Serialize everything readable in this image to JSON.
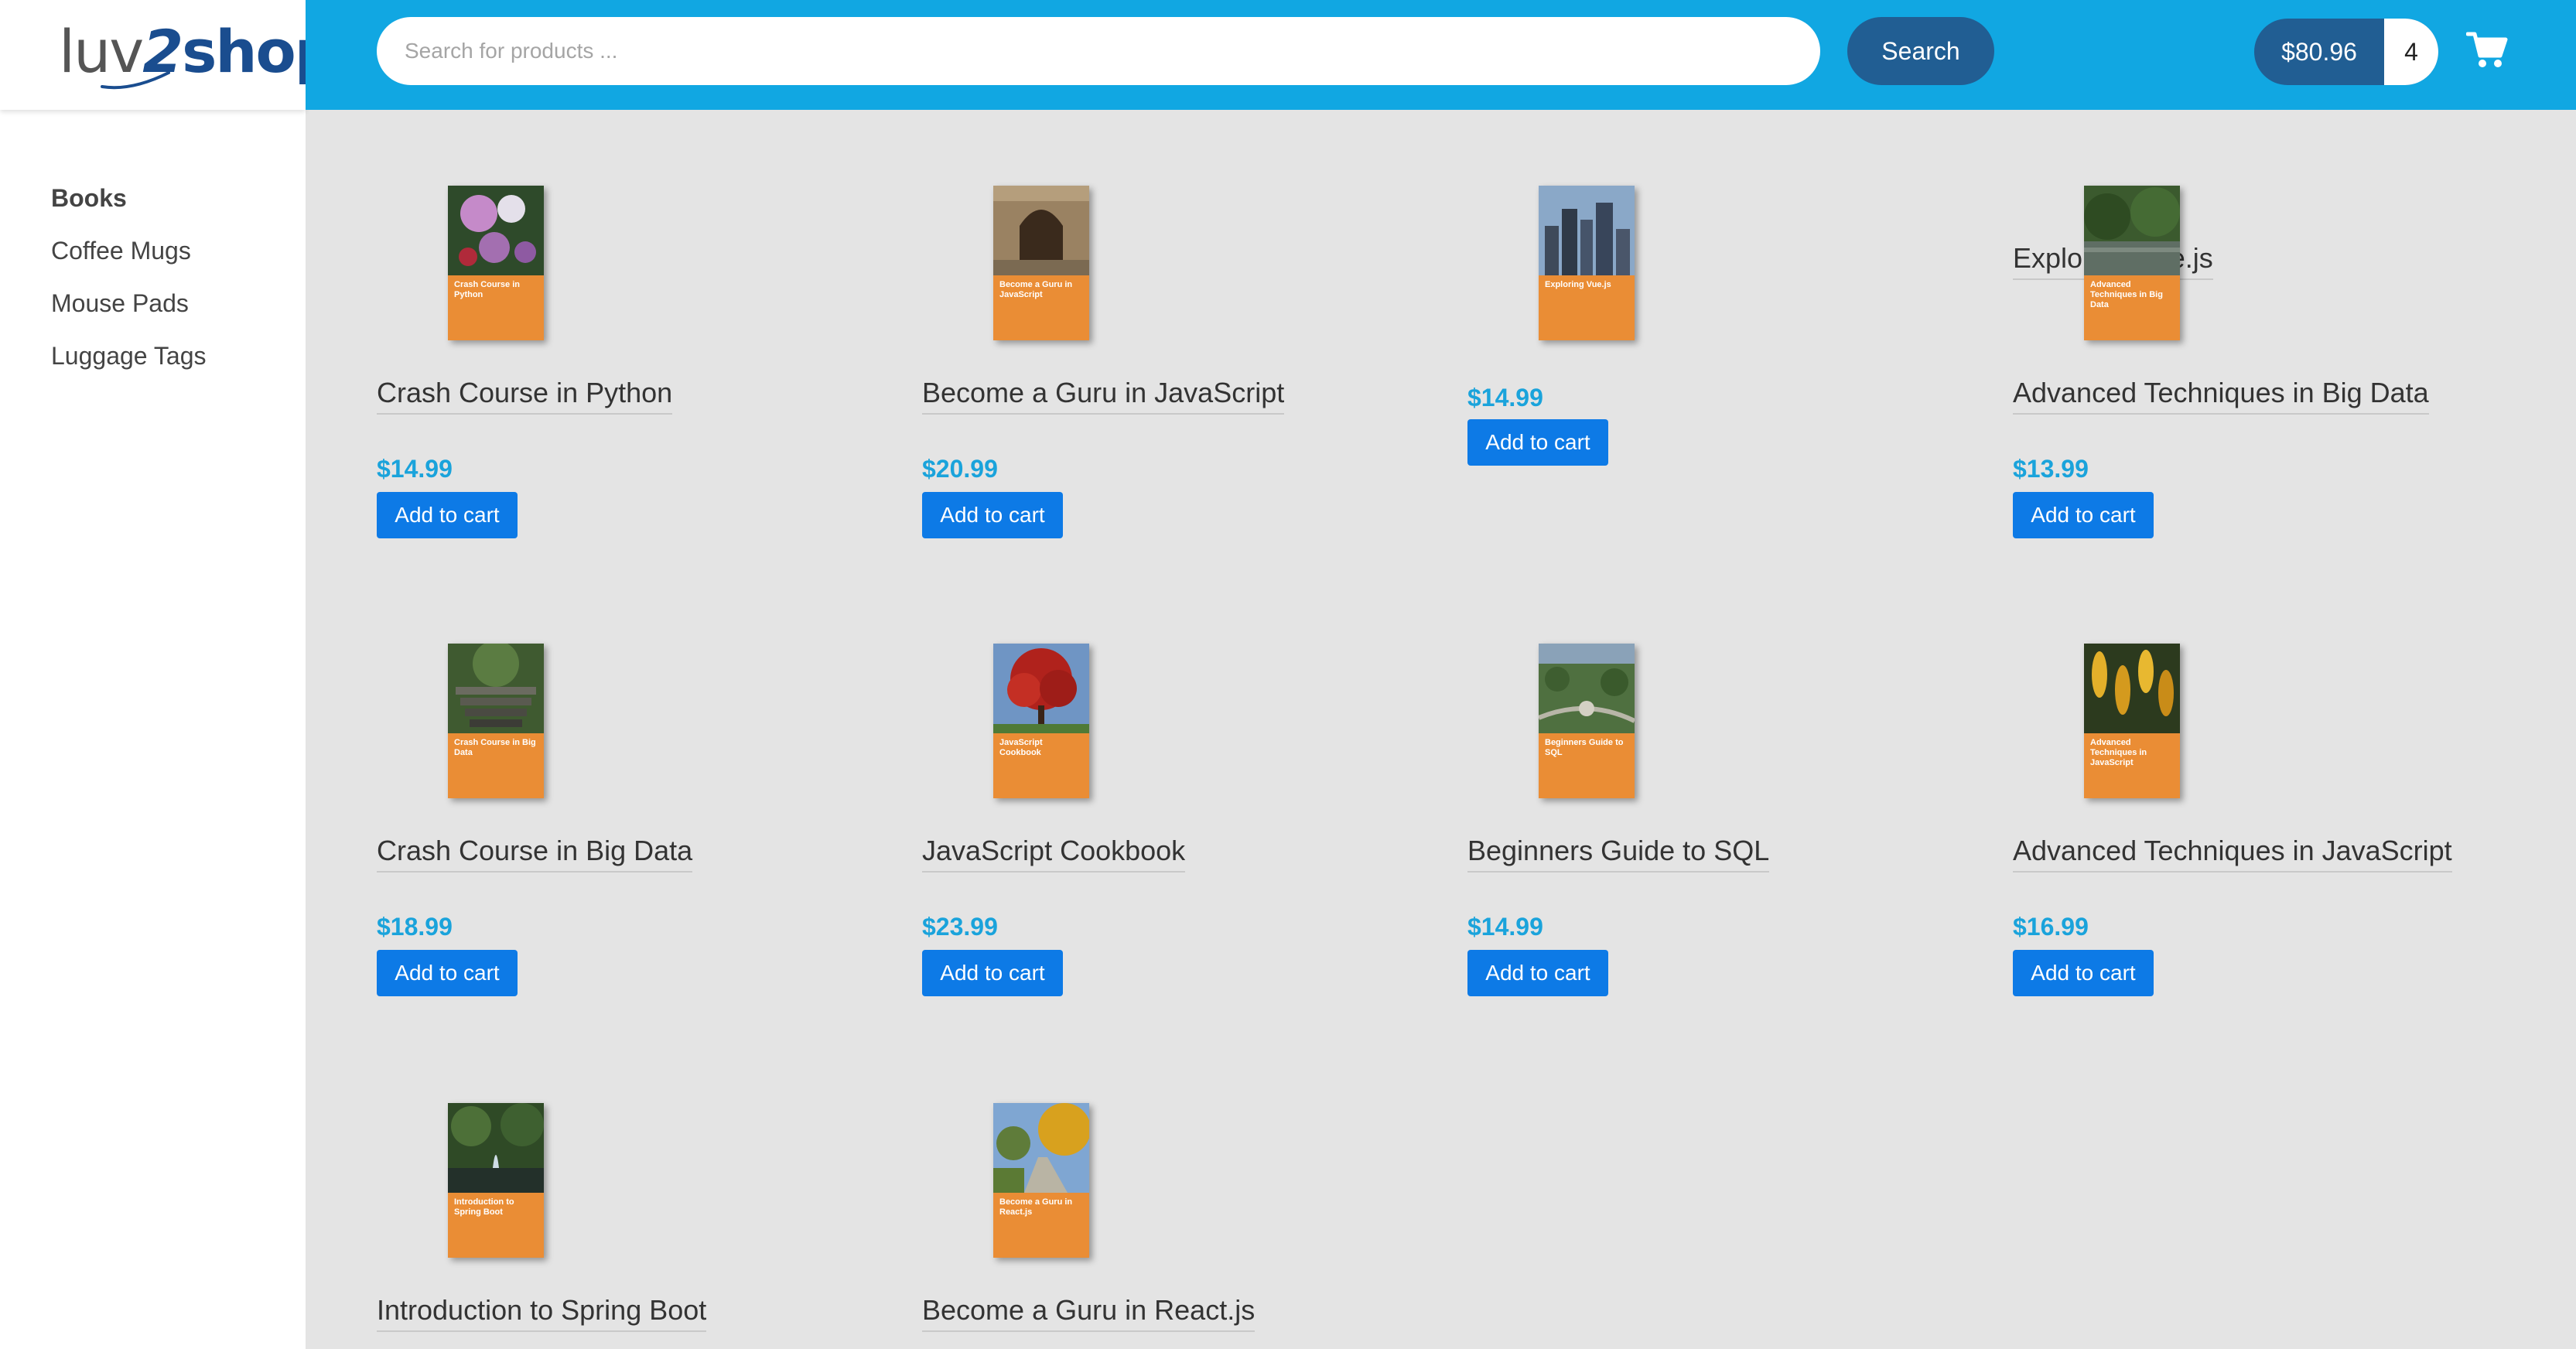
{
  "logo": {
    "part1": "luv",
    "part2": "2",
    "part3": "shop"
  },
  "sidebar": {
    "items": [
      {
        "label": "Books",
        "active": true
      },
      {
        "label": "Coffee Mugs"
      },
      {
        "label": "Mouse Pads"
      },
      {
        "label": "Luggage Tags"
      }
    ]
  },
  "header": {
    "search_placeholder": "Search for products ...",
    "search_button": "Search",
    "cart_total": "$80.96",
    "cart_count": "4",
    "cart_icon": "shopping-cart-icon"
  },
  "products": [
    {
      "name": "Crash Course in Python",
      "price": "$14.99",
      "button": "Add to cart",
      "cover_title": "Crash Course in Python",
      "cover_image": "orchid-flower"
    },
    {
      "name": "Become a Guru in JavaScript",
      "price": "$20.99",
      "button": "Add to cart",
      "cover_title": "Become a Guru in JavaScript",
      "cover_image": "stone-archway"
    },
    {
      "name": "Exploring Vue.js",
      "price": "$14.99",
      "button": "Add to cart",
      "cover_title": "Exploring Vue.js",
      "cover_image": "city-skyline"
    },
    {
      "name": "Advanced Techniques in Big Data",
      "price": "$13.99",
      "button": "Add to cart",
      "cover_title": "Advanced Techniques in Big Data",
      "cover_image": "river-trees"
    },
    {
      "name": "Crash Course in Big Data",
      "price": "$18.99",
      "button": "Add to cart",
      "cover_title": "Crash Course in Big Data",
      "cover_image": "garden-steps"
    },
    {
      "name": "JavaScript Cookbook",
      "price": "$23.99",
      "button": "Add to cart",
      "cover_title": "JavaScript Cookbook",
      "cover_image": "red-tree"
    },
    {
      "name": "Beginners Guide to SQL",
      "price": "$14.99",
      "button": "Add to cart",
      "cover_title": "Beginners Guide to SQL",
      "cover_image": "park-aerial"
    },
    {
      "name": "Advanced Techniques in JavaScript",
      "price": "$16.99",
      "button": "Add to cart",
      "cover_title": "Advanced Techniques in JavaScript",
      "cover_image": "yellow-flowers"
    },
    {
      "name": "Introduction to Spring Boot",
      "price": "",
      "button": "",
      "cover_title": "Introduction to Spring Boot",
      "cover_image": "fountain-garden"
    },
    {
      "name": "Become a Guru in React.js",
      "price": "",
      "button": "",
      "cover_title": "Become a Guru in React.js",
      "cover_image": "autumn-path"
    }
  ],
  "colors": {
    "header": "#11a7e2",
    "dark_blue": "#215e93",
    "price": "#1aa3db",
    "button": "#0d7ae6",
    "cover_band": "#ea8d35",
    "content_bg": "#e4e4e4"
  }
}
